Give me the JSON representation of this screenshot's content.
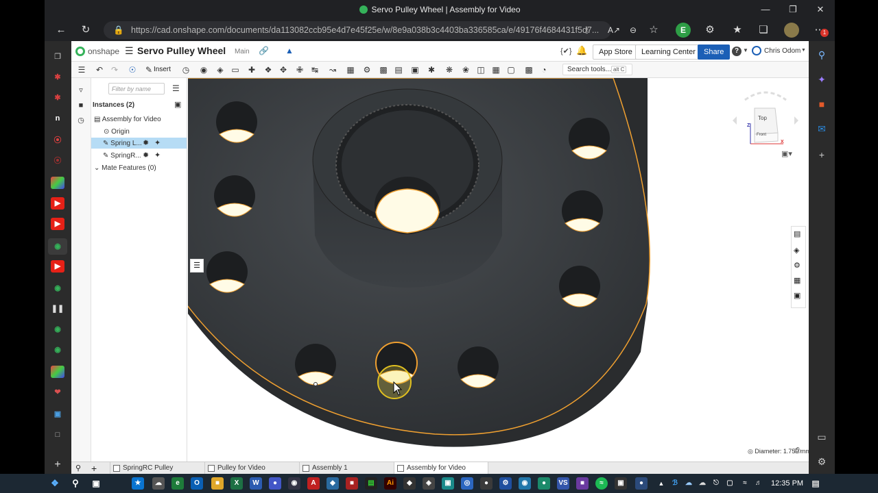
{
  "browser": {
    "window_title": "Servo Pulley Wheel | Assembly for Video",
    "url": "https://cad.onshape.com/documents/da113082ccb95e4d7e45f25e/w/8e9a038b3c4403ba336585ca/e/49176f4684431f5d7...",
    "profile_initial": "E",
    "notification_count": "1"
  },
  "app": {
    "logo_text": "onshape",
    "document_title": "Servo Pulley Wheel",
    "branch": "Main",
    "app_store": "App Store",
    "learning_center": "Learning Center",
    "share": "Share",
    "user_name": "Chris Odom",
    "help": "?",
    "code_icon": "{✔}"
  },
  "toolbar": {
    "insert_label": "Insert",
    "search_tools": "Search tools...",
    "search_shortcut": "alt C"
  },
  "panel": {
    "filter_placeholder": "Filter by name",
    "instances_label": "Instances (2)",
    "tree": {
      "assembly": "Assembly for Video",
      "origin": "Origin",
      "spring_l": "Spring L...",
      "spring_r": "SpringR...",
      "mate_features": "Mate Features (0)"
    }
  },
  "viewcube": {
    "top": "Top",
    "front": "Front",
    "axis_x": "X",
    "axis_z": "Z"
  },
  "status": {
    "measure": "Diameter: 1.750 mm"
  },
  "tabs": [
    {
      "label": "SpringRC Pulley"
    },
    {
      "label": "Pulley for Video"
    },
    {
      "label": "Assembly 1"
    },
    {
      "label": "Assembly for Video"
    }
  ],
  "taskbar": {
    "time": "12:35 PM"
  },
  "colors": {
    "accent_blue": "#1b5fb6",
    "onshape_green": "#35b25a",
    "selection_orange": "#f0a030",
    "part_dark": "#3a3d40"
  }
}
